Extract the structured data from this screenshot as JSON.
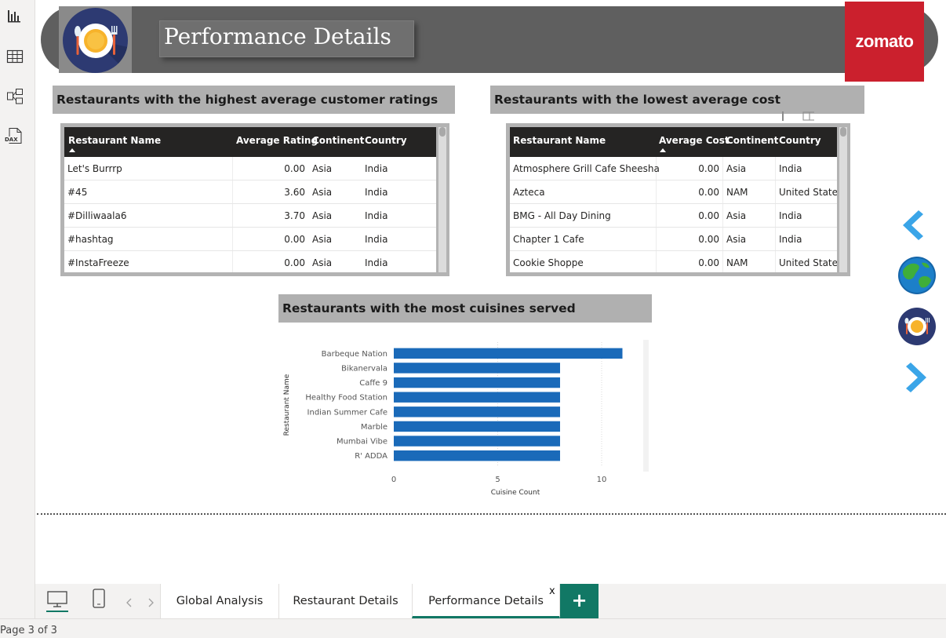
{
  "header": {
    "title": "Performance Details",
    "brand": "zomato",
    "brand_color": "#cb202d"
  },
  "left_rail": {
    "icons": [
      "report-view-icon",
      "table-view-icon",
      "model-view-icon",
      "dax-query-icon"
    ],
    "dax_label": "DAX"
  },
  "top_ratings": {
    "title": "Restaurants with the highest average customer ratings",
    "columns": [
      "Restaurant Name",
      "Average Rating",
      "Continent",
      "Country"
    ],
    "rows": [
      [
        "Let's Burrrp",
        "0.00",
        "Asia",
        "India"
      ],
      [
        "#45",
        "3.60",
        "Asia",
        "India"
      ],
      [
        "#Dilliwaala6",
        "3.70",
        "Asia",
        "India"
      ],
      [
        "#hashtag",
        "0.00",
        "Asia",
        "India"
      ],
      [
        "#InstaFreeze",
        "0.00",
        "Asia",
        "India"
      ]
    ]
  },
  "lowest_cost": {
    "title": "Restaurants with the lowest average cost",
    "columns": [
      "Restaurant Name",
      "Average Cost",
      "Continent",
      "Country"
    ],
    "rows": [
      [
        "Atmosphere Grill Cafe Sheesha",
        "0.00",
        "Asia",
        "India"
      ],
      [
        "Azteca",
        "0.00",
        "NAM",
        "United States"
      ],
      [
        "BMG - All Day Dining",
        "0.00",
        "Asia",
        "India"
      ],
      [
        "Chapter 1 Cafe",
        "0.00",
        "Asia",
        "India"
      ],
      [
        "Cookie Shoppe",
        "0.00",
        "NAM",
        "United States"
      ]
    ]
  },
  "cuisines": {
    "title": "Restaurants with the most cuisines served"
  },
  "chart_data": {
    "type": "bar",
    "orientation": "horizontal",
    "categories": [
      "Barbeque Nation",
      "Bikanervala",
      "Caffe 9",
      "Healthy Food Station",
      "Indian Summer Cafe",
      "Marble",
      "Mumbai Vibe",
      "R' ADDA"
    ],
    "values": [
      11,
      8,
      8,
      8,
      8,
      8,
      8,
      8
    ],
    "xlabel": "Cuisine Count",
    "ylabel": "Restaurant Name",
    "xlim": [
      0,
      12
    ],
    "xticks": [
      0,
      5,
      10
    ],
    "grid": true,
    "bar_color": "#1a6ab9"
  },
  "nav": {
    "icons": [
      "chevron-left-icon",
      "globe-icon",
      "plate-icon",
      "chevron-right-icon"
    ],
    "accent": "#3aa5e8"
  },
  "tabs": {
    "items": [
      "Global Analysis",
      "Restaurant Details",
      "Performance Details"
    ],
    "active": "Performance Details",
    "close_label": "x",
    "add_label": "+",
    "add_color": "#117865"
  },
  "status": {
    "page": "Page 3 of 3"
  }
}
